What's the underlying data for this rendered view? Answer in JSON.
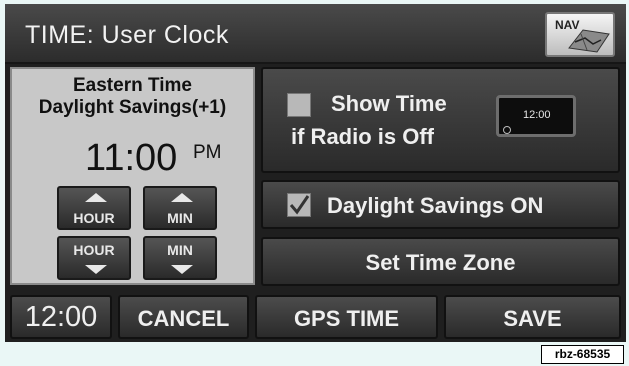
{
  "title_bar": {
    "title": "TIME: User Clock",
    "nav_label": "NAV"
  },
  "clock_panel": {
    "zone_name": "Eastern Time",
    "dst_label": "Daylight Savings(+1)",
    "time": "11:00",
    "ampm": "PM",
    "hour_up_label": "HOUR",
    "min_up_label": "MIN",
    "hour_down_label": "HOUR",
    "min_down_label": "MIN"
  },
  "options": {
    "show_time_line1": "Show Time",
    "show_time_line2": "if Radio is Off",
    "show_time_checked": false,
    "preview_time": "12:00",
    "daylight_label": "Daylight Savings ON",
    "daylight_checked": true,
    "set_zone_label": "Set Time Zone"
  },
  "bottom_bar": {
    "format_label": "12:00",
    "cancel_label": "CANCEL",
    "gps_label": "GPS TIME",
    "save_label": "SAVE"
  },
  "ref_code": "rbz-68535"
}
